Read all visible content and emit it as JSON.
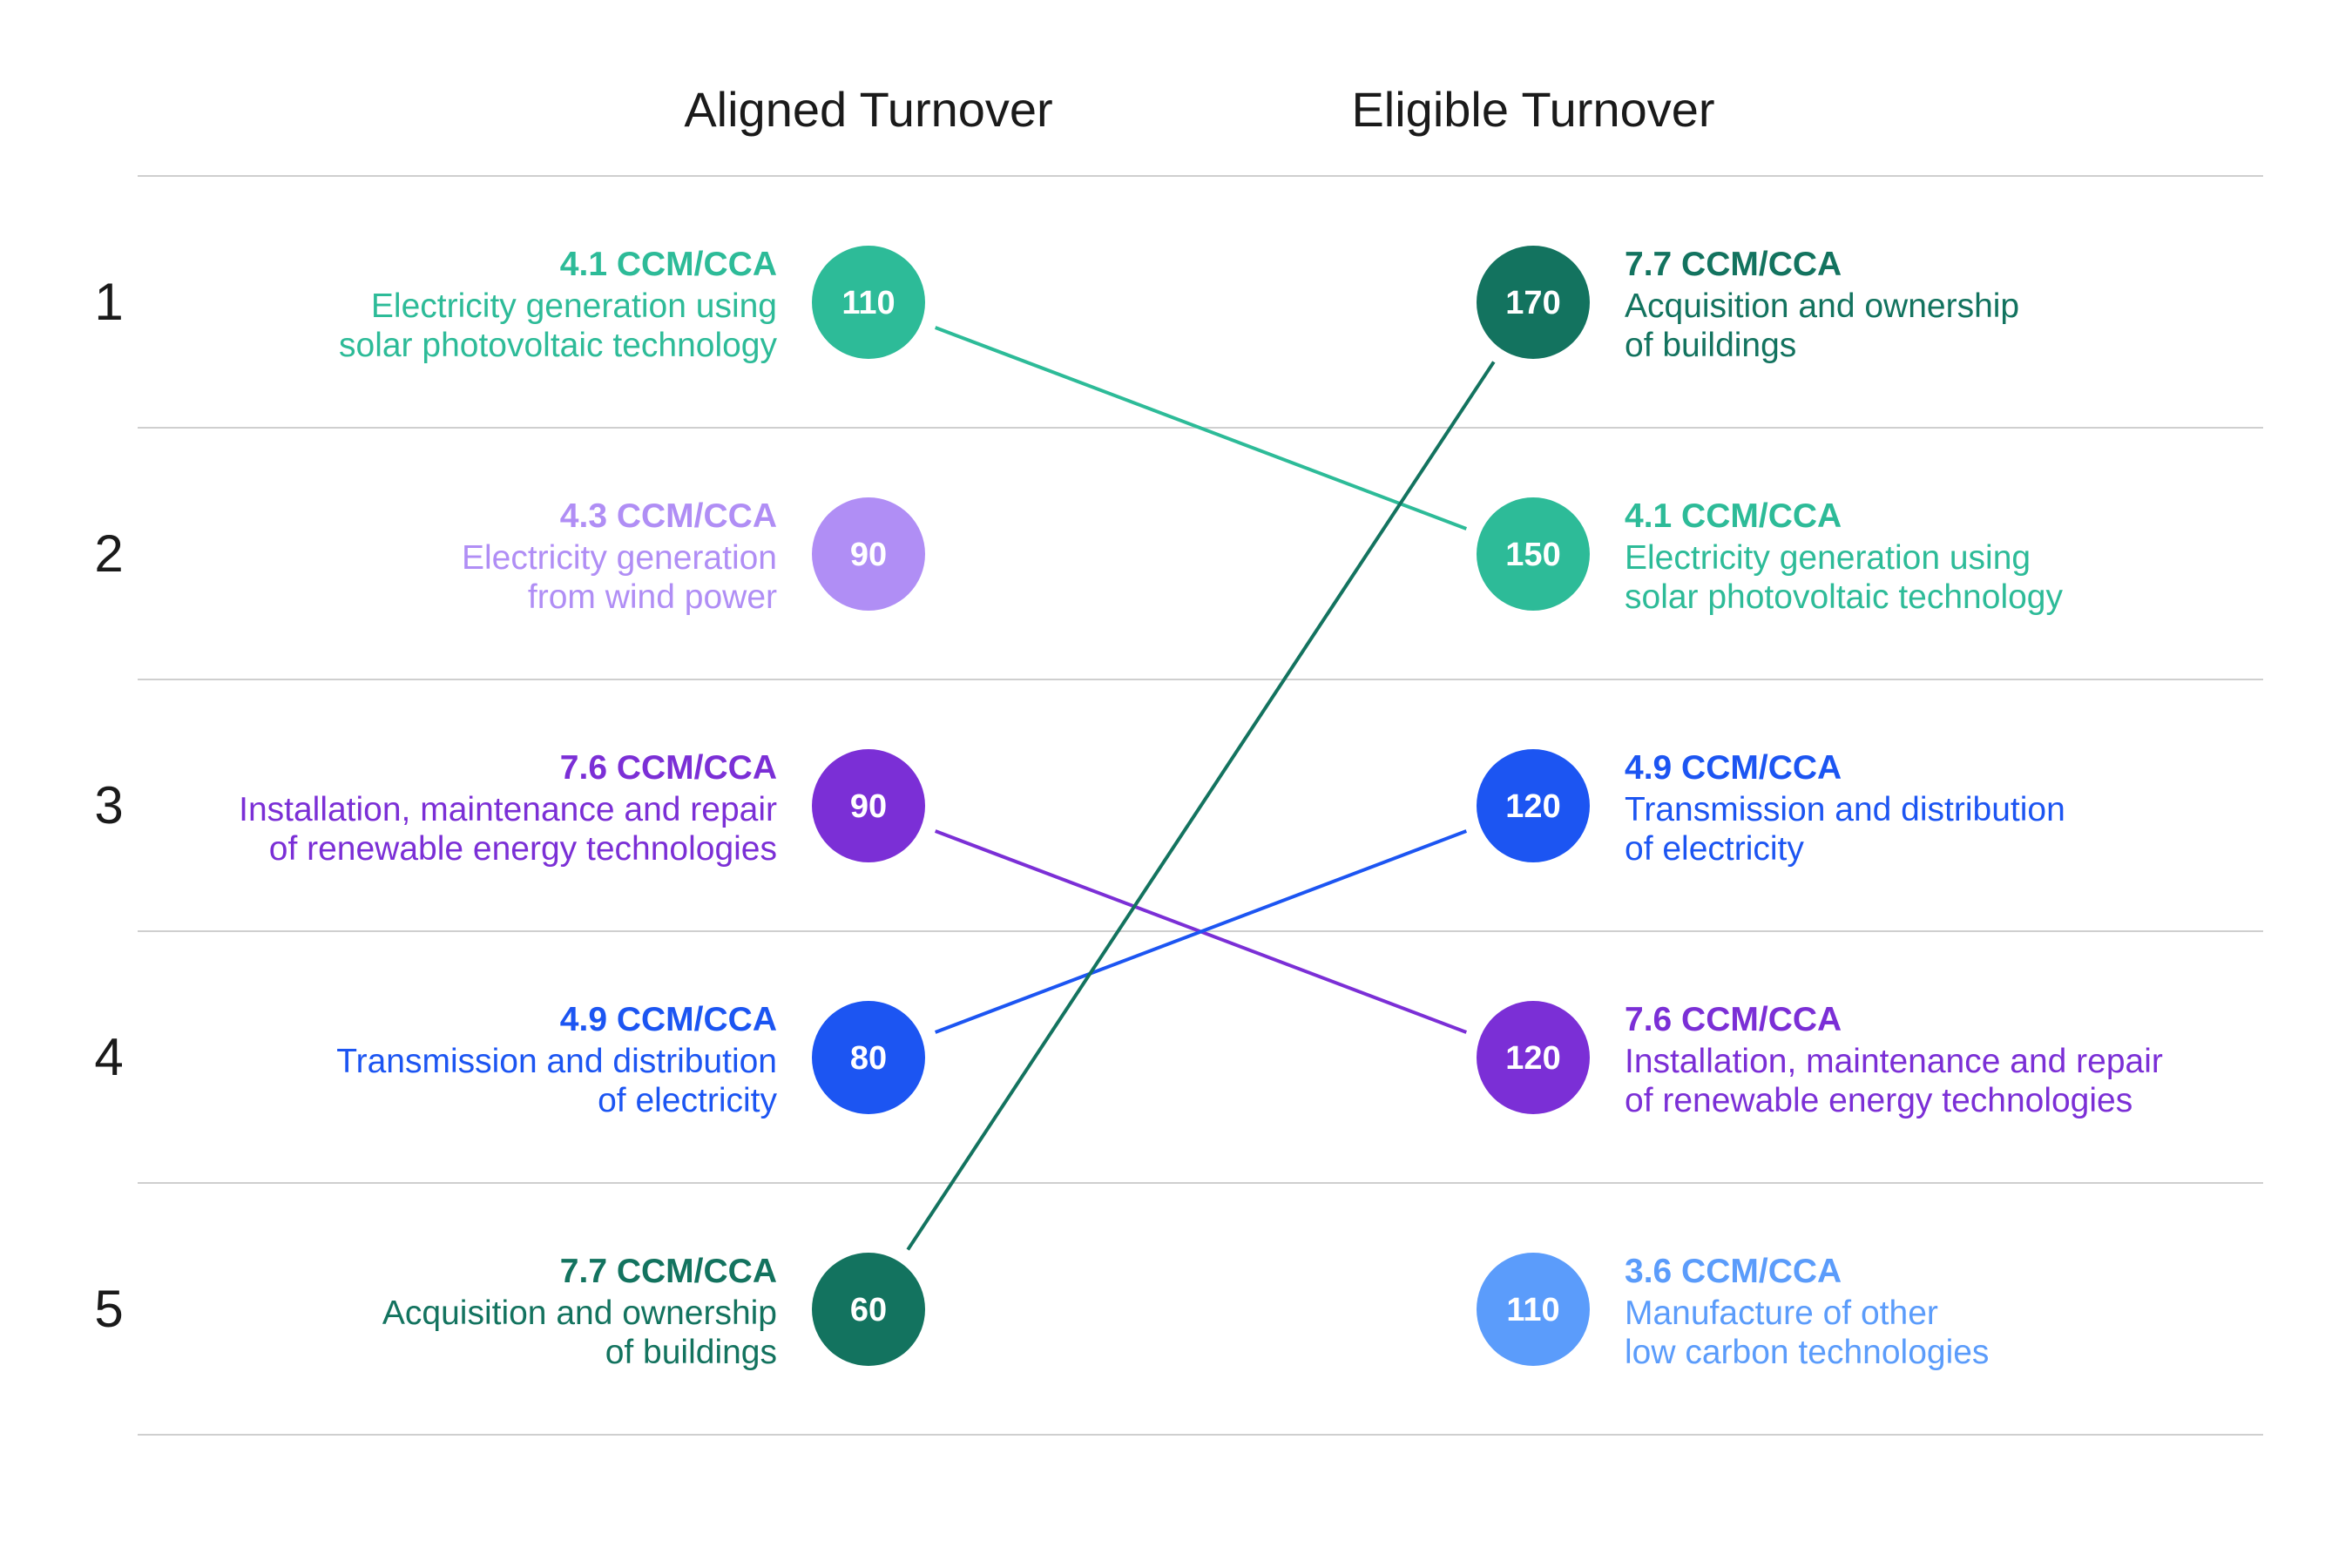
{
  "chart_data": {
    "type": "slope",
    "columns": [
      {
        "key": "aligned",
        "title": "Aligned Turnover"
      },
      {
        "key": "eligible",
        "title": "Eligible Turnover"
      }
    ],
    "ranks": [
      "1",
      "2",
      "3",
      "4",
      "5"
    ],
    "activities": {
      "a77": {
        "code": "7.7 CCM/CCA",
        "desc": [
          "Acquisition and ownership",
          "of buildings"
        ],
        "color": "#13735f"
      },
      "a41": {
        "code": "4.1 CCM/CCA",
        "desc": [
          "Electricity generation using",
          "solar photovoltaic technology"
        ],
        "color": "#2dbb98"
      },
      "a43": {
        "code": "4.3 CCM/CCA",
        "desc": [
          "Electricity generation",
          "from wind power"
        ],
        "color": "#b08ef5"
      },
      "a76": {
        "code": "7.6 CCM/CCA",
        "desc": [
          "Installation, maintenance and repair",
          "of renewable energy technologies"
        ],
        "color": "#7b2fd6"
      },
      "a49": {
        "code": "4.9 CCM/CCA",
        "desc": [
          "Transmission and distribution",
          "of electricity"
        ],
        "color": "#1c55f2"
      },
      "a36": {
        "code": "3.6 CCM/CCA",
        "desc": [
          "Manufacture of other",
          "low carbon technologies"
        ],
        "color": "#5b9cfb"
      }
    },
    "aligned": [
      {
        "rank": 1,
        "activity": "a41",
        "value": 110
      },
      {
        "rank": 2,
        "activity": "a43",
        "value": 90
      },
      {
        "rank": 3,
        "activity": "a76",
        "value": 90
      },
      {
        "rank": 4,
        "activity": "a49",
        "value": 80
      },
      {
        "rank": 5,
        "activity": "a77",
        "value": 60
      }
    ],
    "eligible": [
      {
        "rank": 1,
        "activity": "a77",
        "value": 170
      },
      {
        "rank": 2,
        "activity": "a41",
        "value": 150
      },
      {
        "rank": 3,
        "activity": "a49",
        "value": 120
      },
      {
        "rank": 4,
        "activity": "a76",
        "value": 120
      },
      {
        "rank": 5,
        "activity": "a36",
        "value": 110
      }
    ]
  }
}
